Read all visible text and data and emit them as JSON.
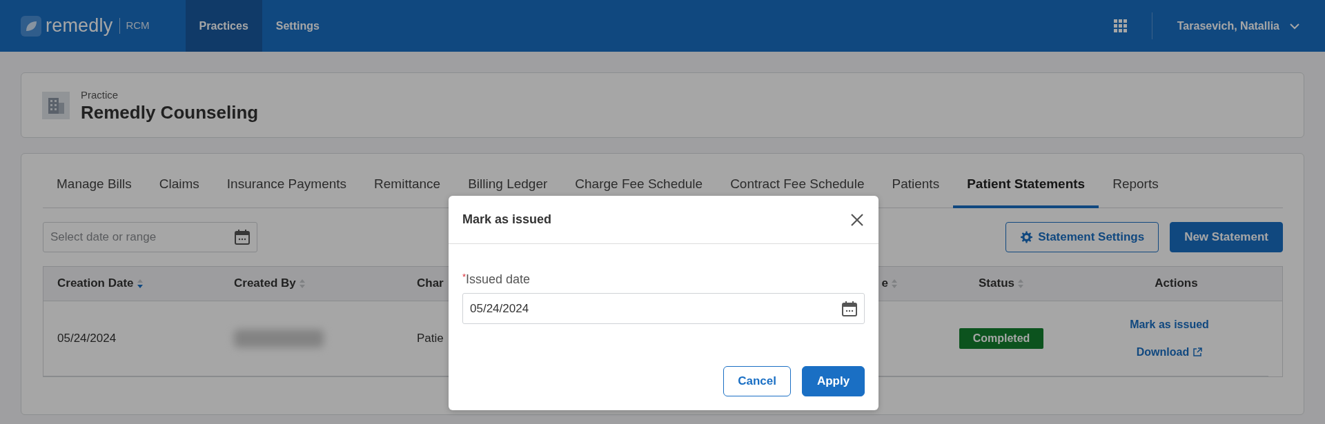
{
  "header": {
    "logo": "remedly",
    "product": "RCM",
    "nav": [
      {
        "label": "Practices",
        "selected": true
      },
      {
        "label": "Settings",
        "selected": false
      }
    ],
    "user": "Tarasevich, Natallia"
  },
  "practice": {
    "caption": "Practice",
    "name": "Remedly Counseling"
  },
  "tabs": [
    {
      "label": "Manage Bills",
      "selected": false
    },
    {
      "label": "Claims",
      "selected": false
    },
    {
      "label": "Insurance Payments",
      "selected": false
    },
    {
      "label": "Remittance",
      "selected": false
    },
    {
      "label": "Billing Ledger",
      "selected": false
    },
    {
      "label": "Charge Fee Schedule",
      "selected": false
    },
    {
      "label": "Contract Fee Schedule",
      "selected": false
    },
    {
      "label": "Patients",
      "selected": false
    },
    {
      "label": "Patient Statements",
      "selected": true
    },
    {
      "label": "Reports",
      "selected": false
    }
  ],
  "date_filter": {
    "placeholder": "Select date or range"
  },
  "toolbar_buttons": [
    {
      "label": "Statement Settings",
      "kind": "outline"
    },
    {
      "label": "New Statement",
      "kind": "primary"
    }
  ],
  "table": {
    "columns": [
      {
        "label": "Creation Date",
        "sorted": true
      },
      {
        "label": "Created By",
        "sorted": false
      },
      {
        "label": "Char"
      },
      {
        "label": "e",
        "sorted": false
      },
      {
        "label": "Status",
        "sorted": false
      },
      {
        "label": "Actions"
      }
    ],
    "rows": [
      {
        "creation_date": "05/24/2024",
        "created_by_blurred": true,
        "column_3": "Patie",
        "status": "Completed",
        "actions": [
          {
            "label": "Mark as issued",
            "external": false
          },
          {
            "label": "Download",
            "external": true
          }
        ]
      }
    ]
  },
  "modal": {
    "title": "Mark as issued",
    "field": {
      "required_mark": "*",
      "label": "Issued date",
      "value": "05/24/2024"
    },
    "buttons": [
      {
        "label": "Cancel",
        "kind": "outline"
      },
      {
        "label": "Apply",
        "kind": "primary"
      }
    ]
  }
}
